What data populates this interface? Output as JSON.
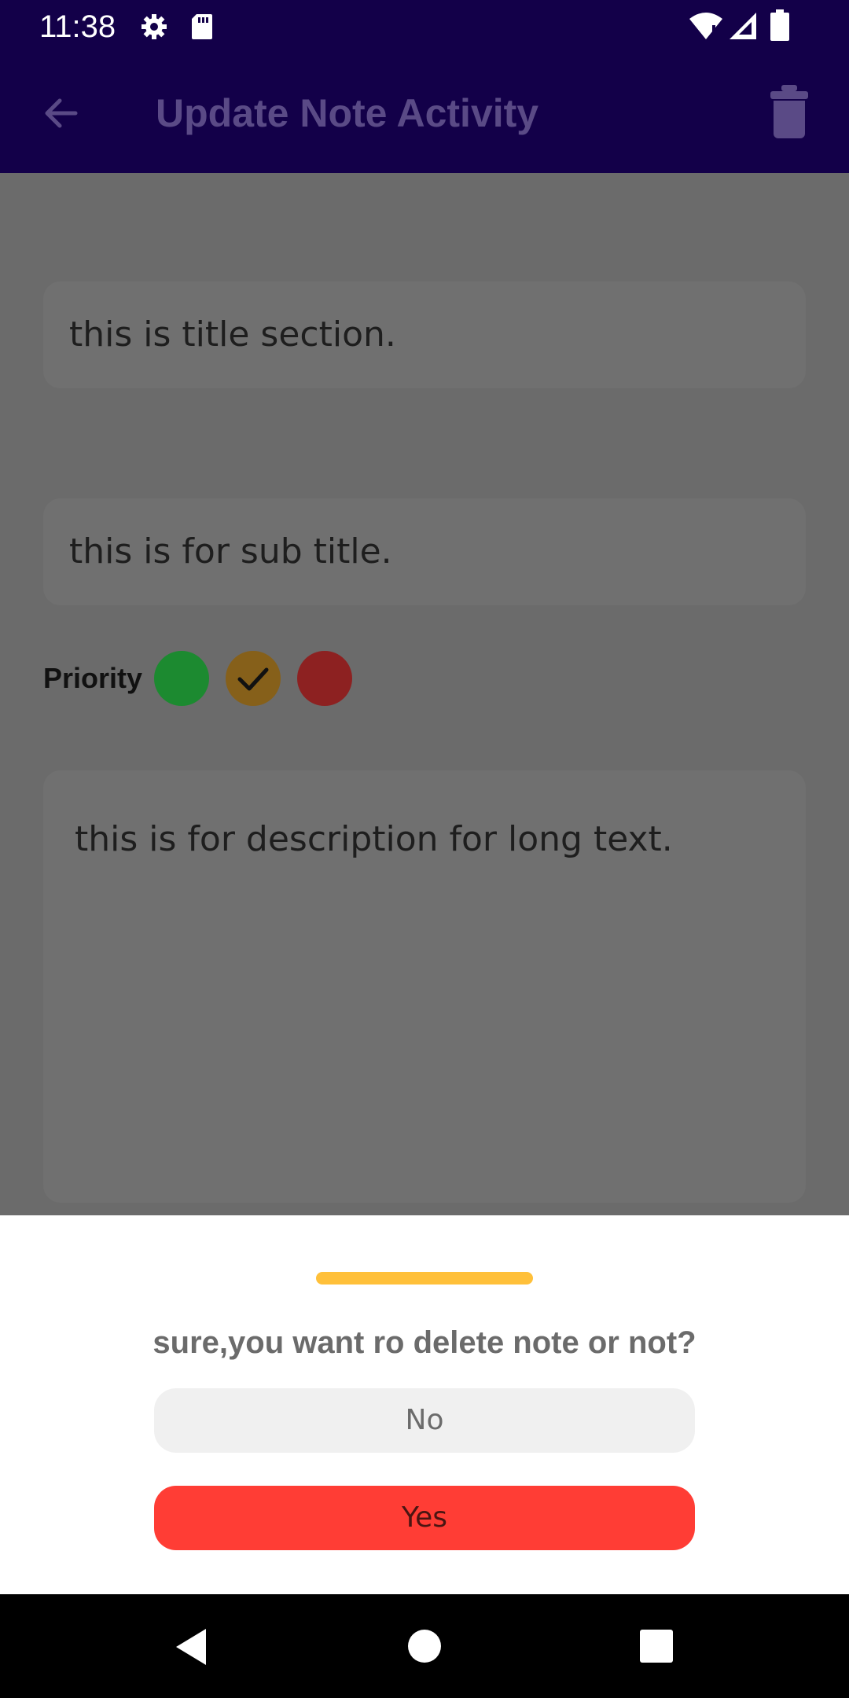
{
  "status_bar": {
    "time": "11:38",
    "icons": [
      "settings-icon",
      "sd-card-icon",
      "wifi-icon",
      "cell-signal-icon",
      "battery-icon"
    ]
  },
  "app_bar": {
    "title": "Update Note Activity",
    "back_icon": "arrow-back-icon",
    "delete_icon": "trash-icon"
  },
  "form": {
    "title_value": "this is title section.",
    "subtitle_value": "this is for sub title.",
    "description_value": "this is for description for long text.",
    "priority_label": "Priority",
    "priority_options": [
      {
        "color": "#1c8a30",
        "selected": false
      },
      {
        "color": "#86601a",
        "selected": true
      },
      {
        "color": "#8d2121",
        "selected": false
      }
    ]
  },
  "bottom_sheet": {
    "question": "sure,you want ro delete note or not?",
    "no_label": "No",
    "yes_label": "Yes"
  },
  "nav_bar": {
    "icons": [
      "back-triangle-icon",
      "home-circle-icon",
      "recents-square-icon"
    ]
  },
  "colors": {
    "app_bar": "#130049",
    "accent_handle": "#ffc03a",
    "yes_button": "#ff3d35"
  }
}
